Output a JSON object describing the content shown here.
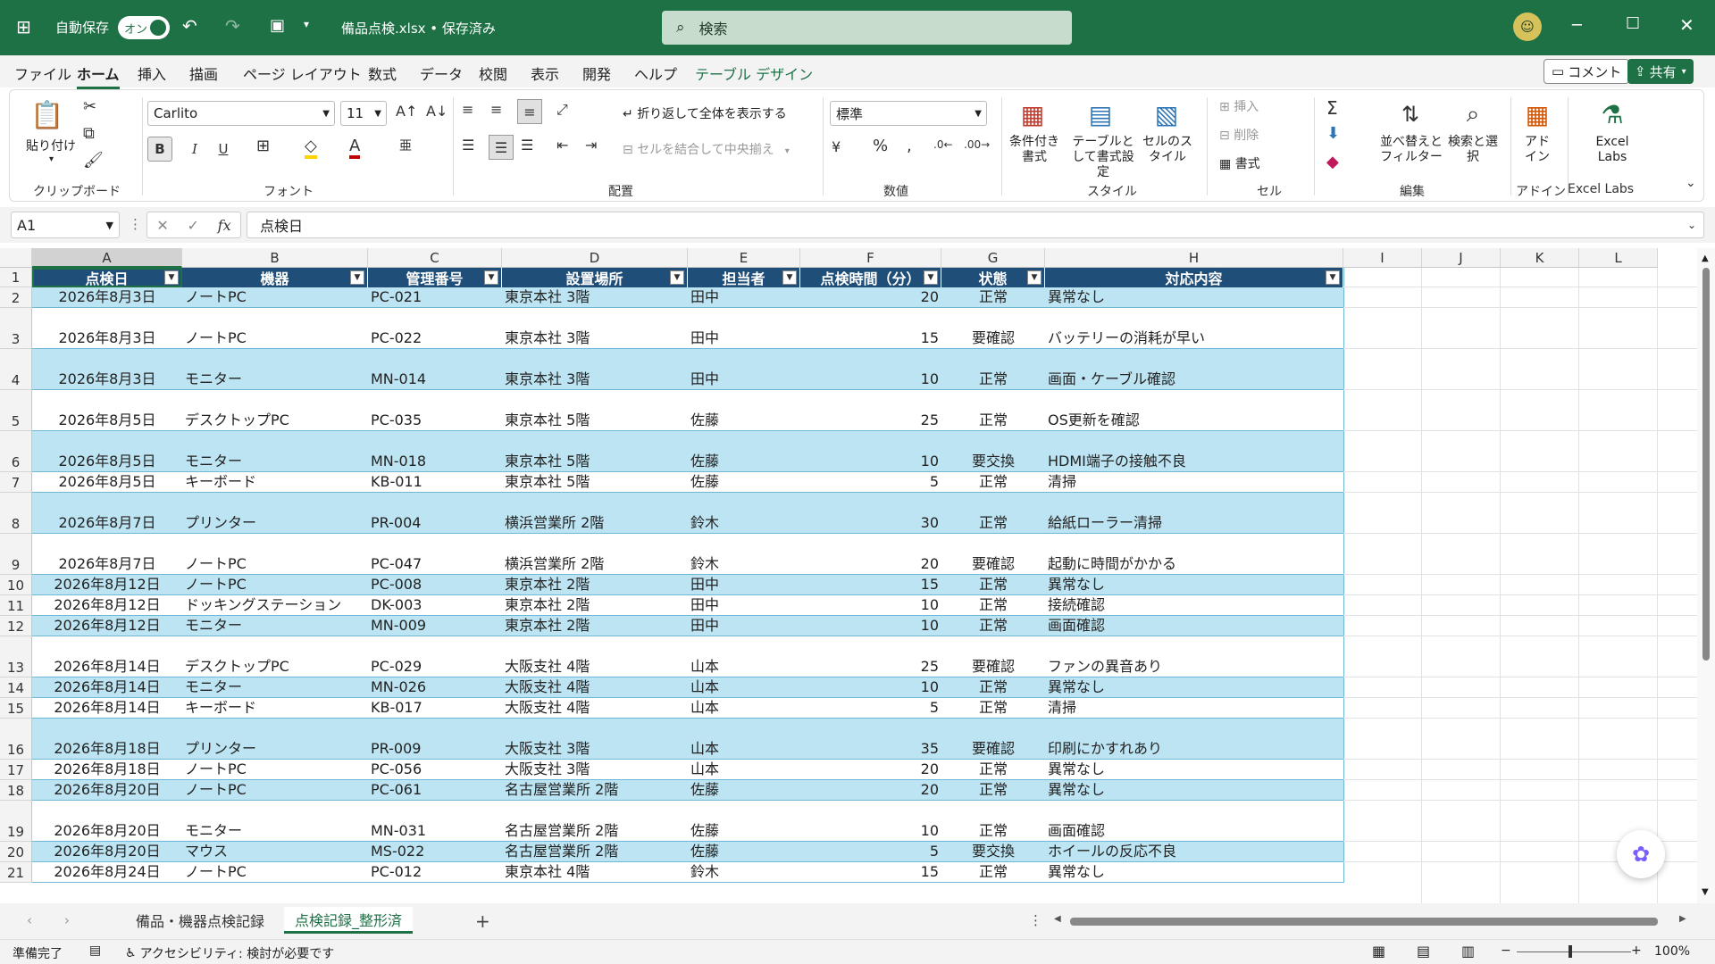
{
  "titlebar": {
    "autosave_label": "自動保存",
    "autosave_state": "オン",
    "file_name": "備品点検.xlsx • 保存済み",
    "search_placeholder": "検索",
    "colors": {
      "accent": "#1e7145",
      "table_header": "#1f4e78",
      "band": "#bde4f2"
    }
  },
  "menu": {
    "items": [
      "ファイル",
      "ホーム",
      "挿入",
      "描画",
      "ページ レイアウト",
      "数式",
      "データ",
      "校閲",
      "表示",
      "開発",
      "ヘルプ",
      "テーブル デザイン"
    ],
    "active": "ホーム",
    "comment_button": "コメント",
    "share_button": "共有"
  },
  "ribbon": {
    "clipboard": {
      "paste": "貼り付け",
      "label": "クリップボード"
    },
    "font": {
      "name": "Carlito",
      "size": "11",
      "label": "フォント",
      "bold": "B",
      "italic": "I",
      "underline": "U"
    },
    "alignment": {
      "wrap_text": "折り返して全体を表示する",
      "merge_center": "セルを結合して中央揃え",
      "label": "配置"
    },
    "number": {
      "format": "標準",
      "label": "数値"
    },
    "styles": {
      "conditional": "条件付き書式",
      "format_table": "テーブルとして書式設定",
      "cell_styles": "セルのスタイル",
      "label": "スタイル"
    },
    "cells": {
      "insert": "挿入",
      "delete": "削除",
      "format": "書式",
      "label": "セル"
    },
    "editing": {
      "sort_filter": "並べ替えとフィルター",
      "find_select": "検索と選択",
      "label": "編集"
    },
    "addins": {
      "addin": "アドイン",
      "label": "アドイン"
    },
    "excel_labs": {
      "btn": "Excel Labs",
      "label": "Excel Labs"
    }
  },
  "formula_bar": {
    "name_box": "A1",
    "fx": "fx",
    "content": "点検日"
  },
  "columns": [
    "A",
    "B",
    "C",
    "D",
    "E",
    "F",
    "G",
    "H",
    "I",
    "J",
    "K",
    "L"
  ],
  "table": {
    "headers": [
      "点検日",
      "機器",
      "管理番号",
      "設置場所",
      "担当者",
      "点検時間（分）",
      "状態",
      "対応内容"
    ],
    "rows": [
      {
        "n": "2",
        "cells": [
          "2026年8月3日",
          "ノートPC",
          "PC-021",
          "東京本社 3階",
          "田中",
          "20",
          "正常",
          "異常なし"
        ]
      },
      {
        "n": "3",
        "cells": [
          "2026年8月3日",
          "ノートPC",
          "PC-022",
          "東京本社 3階",
          "田中",
          "15",
          "要確認",
          "バッテリーの消耗が早い"
        ]
      },
      {
        "n": "4",
        "cells": [
          "2026年8月3日",
          "モニター",
          "MN-014",
          "東京本社 3階",
          "田中",
          "10",
          "正常",
          "画面・ケーブル確認"
        ]
      },
      {
        "n": "5",
        "cells": [
          "2026年8月5日",
          "デスクトップPC",
          "PC-035",
          "東京本社 5階",
          "佐藤",
          "25",
          "正常",
          "OS更新を確認"
        ]
      },
      {
        "n": "6",
        "cells": [
          "2026年8月5日",
          "モニター",
          "MN-018",
          "東京本社 5階",
          "佐藤",
          "10",
          "要交換",
          "HDMI端子の接触不良"
        ]
      },
      {
        "n": "7",
        "cells": [
          "2026年8月5日",
          "キーボード",
          "KB-011",
          "東京本社 5階",
          "佐藤",
          "5",
          "正常",
          "清掃"
        ]
      },
      {
        "n": "8",
        "cells": [
          "2026年8月7日",
          "プリンター",
          "PR-004",
          "横浜営業所 2階",
          "鈴木",
          "30",
          "正常",
          "給紙ローラー清掃"
        ]
      },
      {
        "n": "9",
        "cells": [
          "2026年8月7日",
          "ノートPC",
          "PC-047",
          "横浜営業所 2階",
          "鈴木",
          "20",
          "要確認",
          "起動に時間がかかる"
        ]
      },
      {
        "n": "10",
        "cells": [
          "2026年8月12日",
          "ノートPC",
          "PC-008",
          "東京本社 2階",
          "田中",
          "15",
          "正常",
          "異常なし"
        ]
      },
      {
        "n": "11",
        "cells": [
          "2026年8月12日",
          "ドッキングステーション",
          "DK-003",
          "東京本社 2階",
          "田中",
          "10",
          "正常",
          "接続確認"
        ]
      },
      {
        "n": "12",
        "cells": [
          "2026年8月12日",
          "モニター",
          "MN-009",
          "東京本社 2階",
          "田中",
          "10",
          "正常",
          "画面確認"
        ]
      },
      {
        "n": "13",
        "cells": [
          "2026年8月14日",
          "デスクトップPC",
          "PC-029",
          "大阪支社 4階",
          "山本",
          "25",
          "要確認",
          "ファンの異音あり"
        ]
      },
      {
        "n": "14",
        "cells": [
          "2026年8月14日",
          "モニター",
          "MN-026",
          "大阪支社 4階",
          "山本",
          "10",
          "正常",
          "異常なし"
        ]
      },
      {
        "n": "15",
        "cells": [
          "2026年8月14日",
          "キーボード",
          "KB-017",
          "大阪支社 4階",
          "山本",
          "5",
          "正常",
          "清掃"
        ]
      },
      {
        "n": "16",
        "cells": [
          "2026年8月18日",
          "プリンター",
          "PR-009",
          "大阪支社 3階",
          "山本",
          "35",
          "要確認",
          "印刷にかすれあり"
        ]
      },
      {
        "n": "17",
        "cells": [
          "2026年8月18日",
          "ノートPC",
          "PC-056",
          "大阪支社 3階",
          "山本",
          "20",
          "正常",
          "異常なし"
        ]
      },
      {
        "n": "18",
        "cells": [
          "2026年8月20日",
          "ノートPC",
          "PC-061",
          "名古屋営業所 2階",
          "佐藤",
          "20",
          "正常",
          "異常なし"
        ]
      },
      {
        "n": "19",
        "cells": [
          "2026年8月20日",
          "モニター",
          "MN-031",
          "名古屋営業所 2階",
          "佐藤",
          "10",
          "正常",
          "画面確認"
        ]
      },
      {
        "n": "20",
        "cells": [
          "2026年8月20日",
          "マウス",
          "MS-022",
          "名古屋営業所 2階",
          "佐藤",
          "5",
          "要交換",
          "ホイールの反応不良"
        ]
      },
      {
        "n": "21",
        "cells": [
          "2026年8月24日",
          "ノートPC",
          "PC-012",
          "東京本社 4階",
          "鈴木",
          "15",
          "正常",
          "異常なし"
        ]
      }
    ]
  },
  "sheets": {
    "tabs": [
      "備品・機器点検記録",
      "点検記録_整形済"
    ],
    "active": "点検記録_整形済",
    "add": "+"
  },
  "status": {
    "ready": "準備完了",
    "accessibility": "アクセシビリティ: 検討が必要です",
    "zoom": "100%"
  }
}
